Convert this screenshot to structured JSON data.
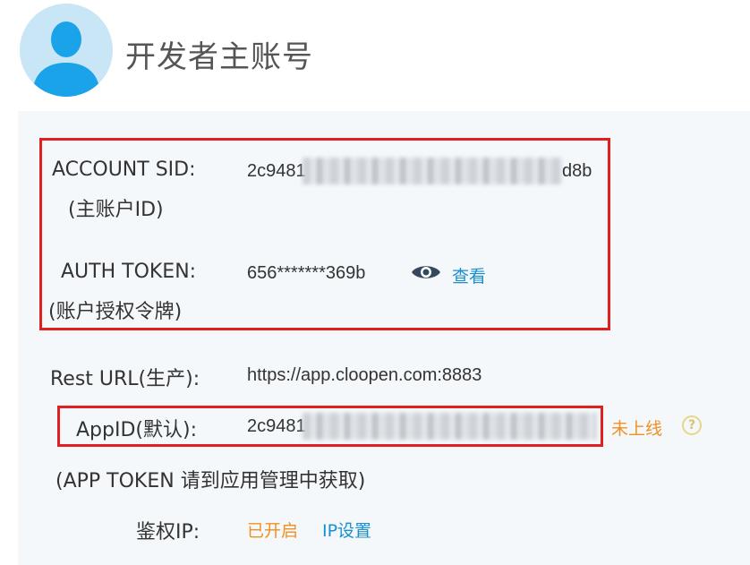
{
  "header": {
    "title": "开发者主账号",
    "avatar_icon": "user-avatar-icon"
  },
  "account": {
    "sid_label": "ACCOUNT SID:",
    "sid_sublabel": "(主账户ID)",
    "sid_prefix": "2c9481",
    "sid_suffix": "d8b",
    "token_label": "AUTH TOKEN:",
    "token_sublabel": "(账户授权令牌)",
    "token_value": "656*******369b",
    "view_label": "查看",
    "view_icon": "eye-icon"
  },
  "rest": {
    "label": "Rest URL(生产):",
    "value": "https://app.cloopen.com:8883"
  },
  "app": {
    "label": "AppID(默认):",
    "prefix": "2c9481",
    "status": "未上线",
    "help_icon": "question-circle-icon",
    "token_note": "(APP TOKEN 请到应用管理中获取)"
  },
  "auth_ip": {
    "label": "鉴权IP:",
    "status": "已开启",
    "settings_link": "IP设置"
  },
  "colors": {
    "accent_blue": "#1a8fd0",
    "warning_orange": "#f09020",
    "highlight_red": "#e02020",
    "panel_bg": "#f4f8fb"
  }
}
